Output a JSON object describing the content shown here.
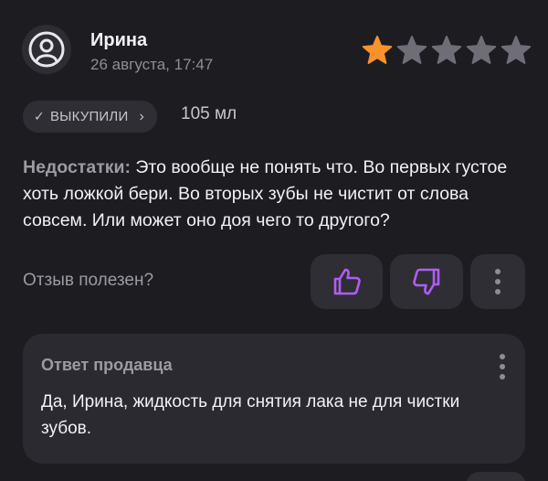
{
  "review": {
    "author": "Ирина",
    "date": "26 августа, 17:47",
    "rating": 1,
    "rating_max": 5,
    "badge": {
      "check_icon": "check-icon",
      "label": "ВЫКУПИЛИ",
      "chevron": "›"
    },
    "volume": "105 мл",
    "cons_label": "Недостатки:",
    "cons_text": " Это вообще не понять что. Во первых густое хоть ложкой бери. Во вторых зубы не чистит от слова совсем. Или может оно доя чего то другого?"
  },
  "helpful": {
    "question": "Отзыв полезен?"
  },
  "seller_reply": {
    "title": "Ответ продавца",
    "text": "Да, Ирина, жидкость для снятия лака не для чистки зубов."
  },
  "colors": {
    "background": "#1d1c21",
    "card": "#2b2a30",
    "star_active": "#f7922d",
    "star_inactive": "#6f6e77",
    "accent": "#b15cf5"
  }
}
